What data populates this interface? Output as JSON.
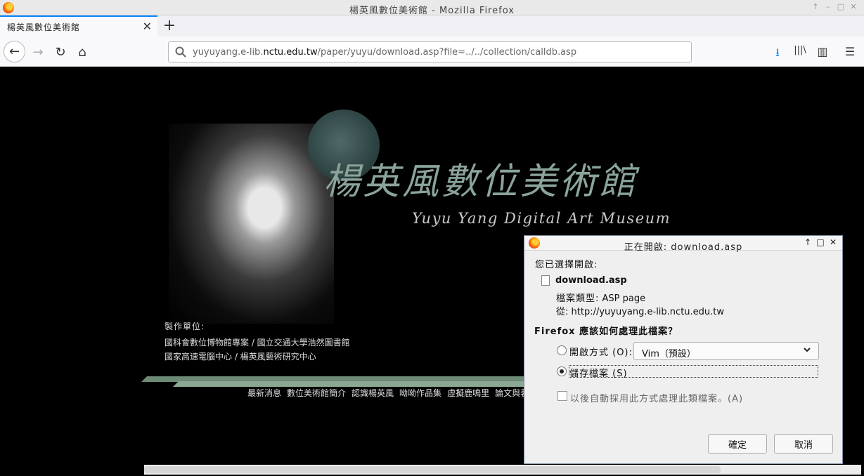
{
  "window": {
    "title": "楊英風數位美術館 - Mozilla Firefox",
    "controls": [
      "↑",
      "–",
      "□",
      "✕"
    ]
  },
  "tab": {
    "label": "楊英風數位美術館",
    "close": "✕",
    "new_tab": "+"
  },
  "nav": {
    "back": "←",
    "forward": "→",
    "reload": "↻",
    "home": "⌂"
  },
  "urlbar": {
    "url_prefix": "yuyuyang.e-lib.",
    "url_host": "nctu.edu.tw",
    "url_path": "/paper/yuyu/download.asp?file=../../collection/calldb.asp"
  },
  "toolbar": {
    "downloads": "⭳",
    "library": "|||\\",
    "sidebar": "▥",
    "menu": "☰"
  },
  "page": {
    "calligraphy": "楊英風數位美術館",
    "museum_title": "Yuyu Yang Digital Art Museum",
    "credits_label": "製作單位:",
    "credits": [
      "國科會數位博物館專案 / 國立交通大學浩然圖書館",
      "國家高速電腦中心 / 楊英風藝術研究中心"
    ],
    "menu_items": [
      "最新消息",
      "數位美術館簡介",
      "認識楊英風",
      "呦呦作品集",
      "虛擬鹿鳴里",
      "論文與著"
    ]
  },
  "dialog": {
    "title": "正在開啟: download.asp",
    "controls": [
      "↑",
      "□",
      "✕"
    ],
    "heading": "您已選擇開啟:",
    "filename": "download.asp",
    "type_label": "檔案類型:",
    "type_value": "ASP page",
    "from_label": "從:",
    "from_value": "http://yuyuyang.e-lib.nctu.edu.tw",
    "question": "Firefox 應該如何處理此檔案？",
    "open_with_label": "開啟方式 (O):",
    "open_with_value": "Vim（預設）",
    "chevron": "⌄",
    "save_label": "儲存檔案 (S)",
    "remember_label": "以後自動採用此方式處理此類檔案。(A)",
    "ok_label": "確定",
    "cancel_label": "取消"
  }
}
